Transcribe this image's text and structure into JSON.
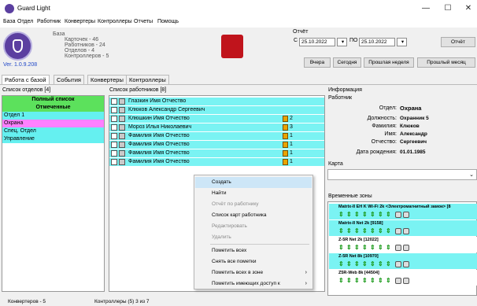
{
  "window": {
    "title": "Guard Light",
    "minimize": "—",
    "maximize": "☐",
    "close": "✕"
  },
  "menu": [
    "База",
    "Отдел",
    "Работник",
    "Конвертеры",
    "Контроллеры",
    "Отчеты",
    "Помощь"
  ],
  "version": "Ver. 1.0.9.208",
  "base": {
    "heading": "База",
    "lines": [
      "Карточек - 46",
      "Работников - 24",
      "Отделов - 4",
      "Контроллеров - 5"
    ]
  },
  "report": {
    "heading": "Отчёт",
    "from_label": "С",
    "from_date": "25.10.2022",
    "to_label": "ПО",
    "to_date": "25.10.2022",
    "report_btn": "Отчёт",
    "buttons": [
      "Вчера",
      "Сегодня",
      "Прошлая неделя",
      "Прошлый месяц"
    ]
  },
  "tabs": [
    "Работа с базой",
    "События",
    "Конвертеры",
    "Контроллеры"
  ],
  "dept_panel": {
    "title": "Список отделов [4]",
    "items": [
      "Полный список",
      "Отмеченные",
      "Отдел 1",
      "Охрана",
      "Спец. Отдел",
      "Управление"
    ]
  },
  "emp_panel": {
    "title": "Список работников [8]",
    "rows": [
      {
        "name": "Глазкин Имя Отчество",
        "count": ""
      },
      {
        "name": "Клюков Александр Сергеевич",
        "count": ""
      },
      {
        "name": "Клюшкин Имя Отчество",
        "count": "2"
      },
      {
        "name": "Мороз Илья Николаевич",
        "count": "3"
      },
      {
        "name": "Фамилия Имя Отчество",
        "count": "1"
      },
      {
        "name": "Фамилия Имя Отчество",
        "count": "1"
      },
      {
        "name": "Фамилия Имя Отчество",
        "count": "1"
      },
      {
        "name": "Фамилия Имя Отчество",
        "count": "1"
      }
    ]
  },
  "context_menu": [
    "Создать",
    "Найти",
    "Отчёт по работнику",
    "Список карт работника",
    "Редактировать",
    "Удалить",
    "Пометить всех",
    "Снять все пометки",
    "Пометить всех в зоне",
    "Пометить имеющих доступ к"
  ],
  "info": {
    "heading": "Информация",
    "worker": "Работник",
    "dept_label": "Отдел:",
    "dept_value": "Охрана",
    "position_label": "Должность:",
    "position_value": "Охранник 5",
    "surname_label": "Фамилия:",
    "surname_value": "Клюков",
    "name_label": "Имя:",
    "name_value": "Александр",
    "patronymic_label": "Отчество:",
    "patronymic_value": "Сергеевич",
    "birth_label": "Дата рождения:",
    "birth_value": "01.01.1985"
  },
  "map_label": "Карта",
  "zones": {
    "heading": "Временные зоны",
    "items": [
      "Matrix-II EH K Wi-Fi 2k <Электромагнитный замок> [8",
      "Matrix-II Net 2k [9158]",
      "Z-5R Net 2k [12022]",
      "Z-5R Net 8k [10970]",
      "Z5R-Web 8k [44504]"
    ]
  },
  "status": [
    "Конвертеров - 5",
    "Контроллеры (5) 3 из 7"
  ]
}
